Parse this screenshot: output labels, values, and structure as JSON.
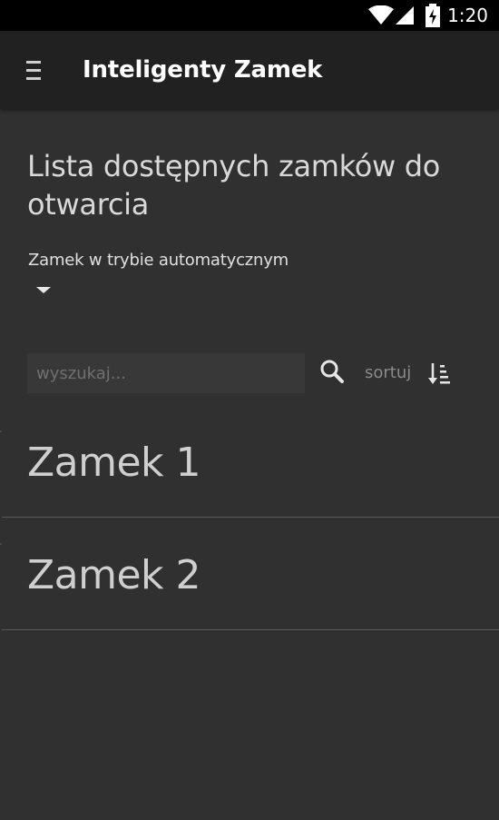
{
  "status_bar": {
    "time": "1:20",
    "icons": [
      "wifi-icon",
      "cellular-signal-icon",
      "battery-charging-icon"
    ]
  },
  "app_bar": {
    "menu_icon": "menu-icon",
    "title": "Inteligenty Zamek"
  },
  "content": {
    "heading": "Lista dostępnych zamków do otwarcia",
    "mode_label": "Zamek w trybie automatycznym",
    "search": {
      "value": "",
      "placeholder": "wyszukaj...",
      "icon": "search-icon"
    },
    "sort": {
      "label": "sortuj",
      "icon": "sort-ascending-icon"
    },
    "locks": [
      {
        "name": "Zamek 1"
      },
      {
        "name": "Zamek 2"
      }
    ]
  },
  "colors": {
    "background": "#303030",
    "app_bar": "#212121",
    "status_bar": "#000000",
    "divider": "#5a5a5a"
  }
}
